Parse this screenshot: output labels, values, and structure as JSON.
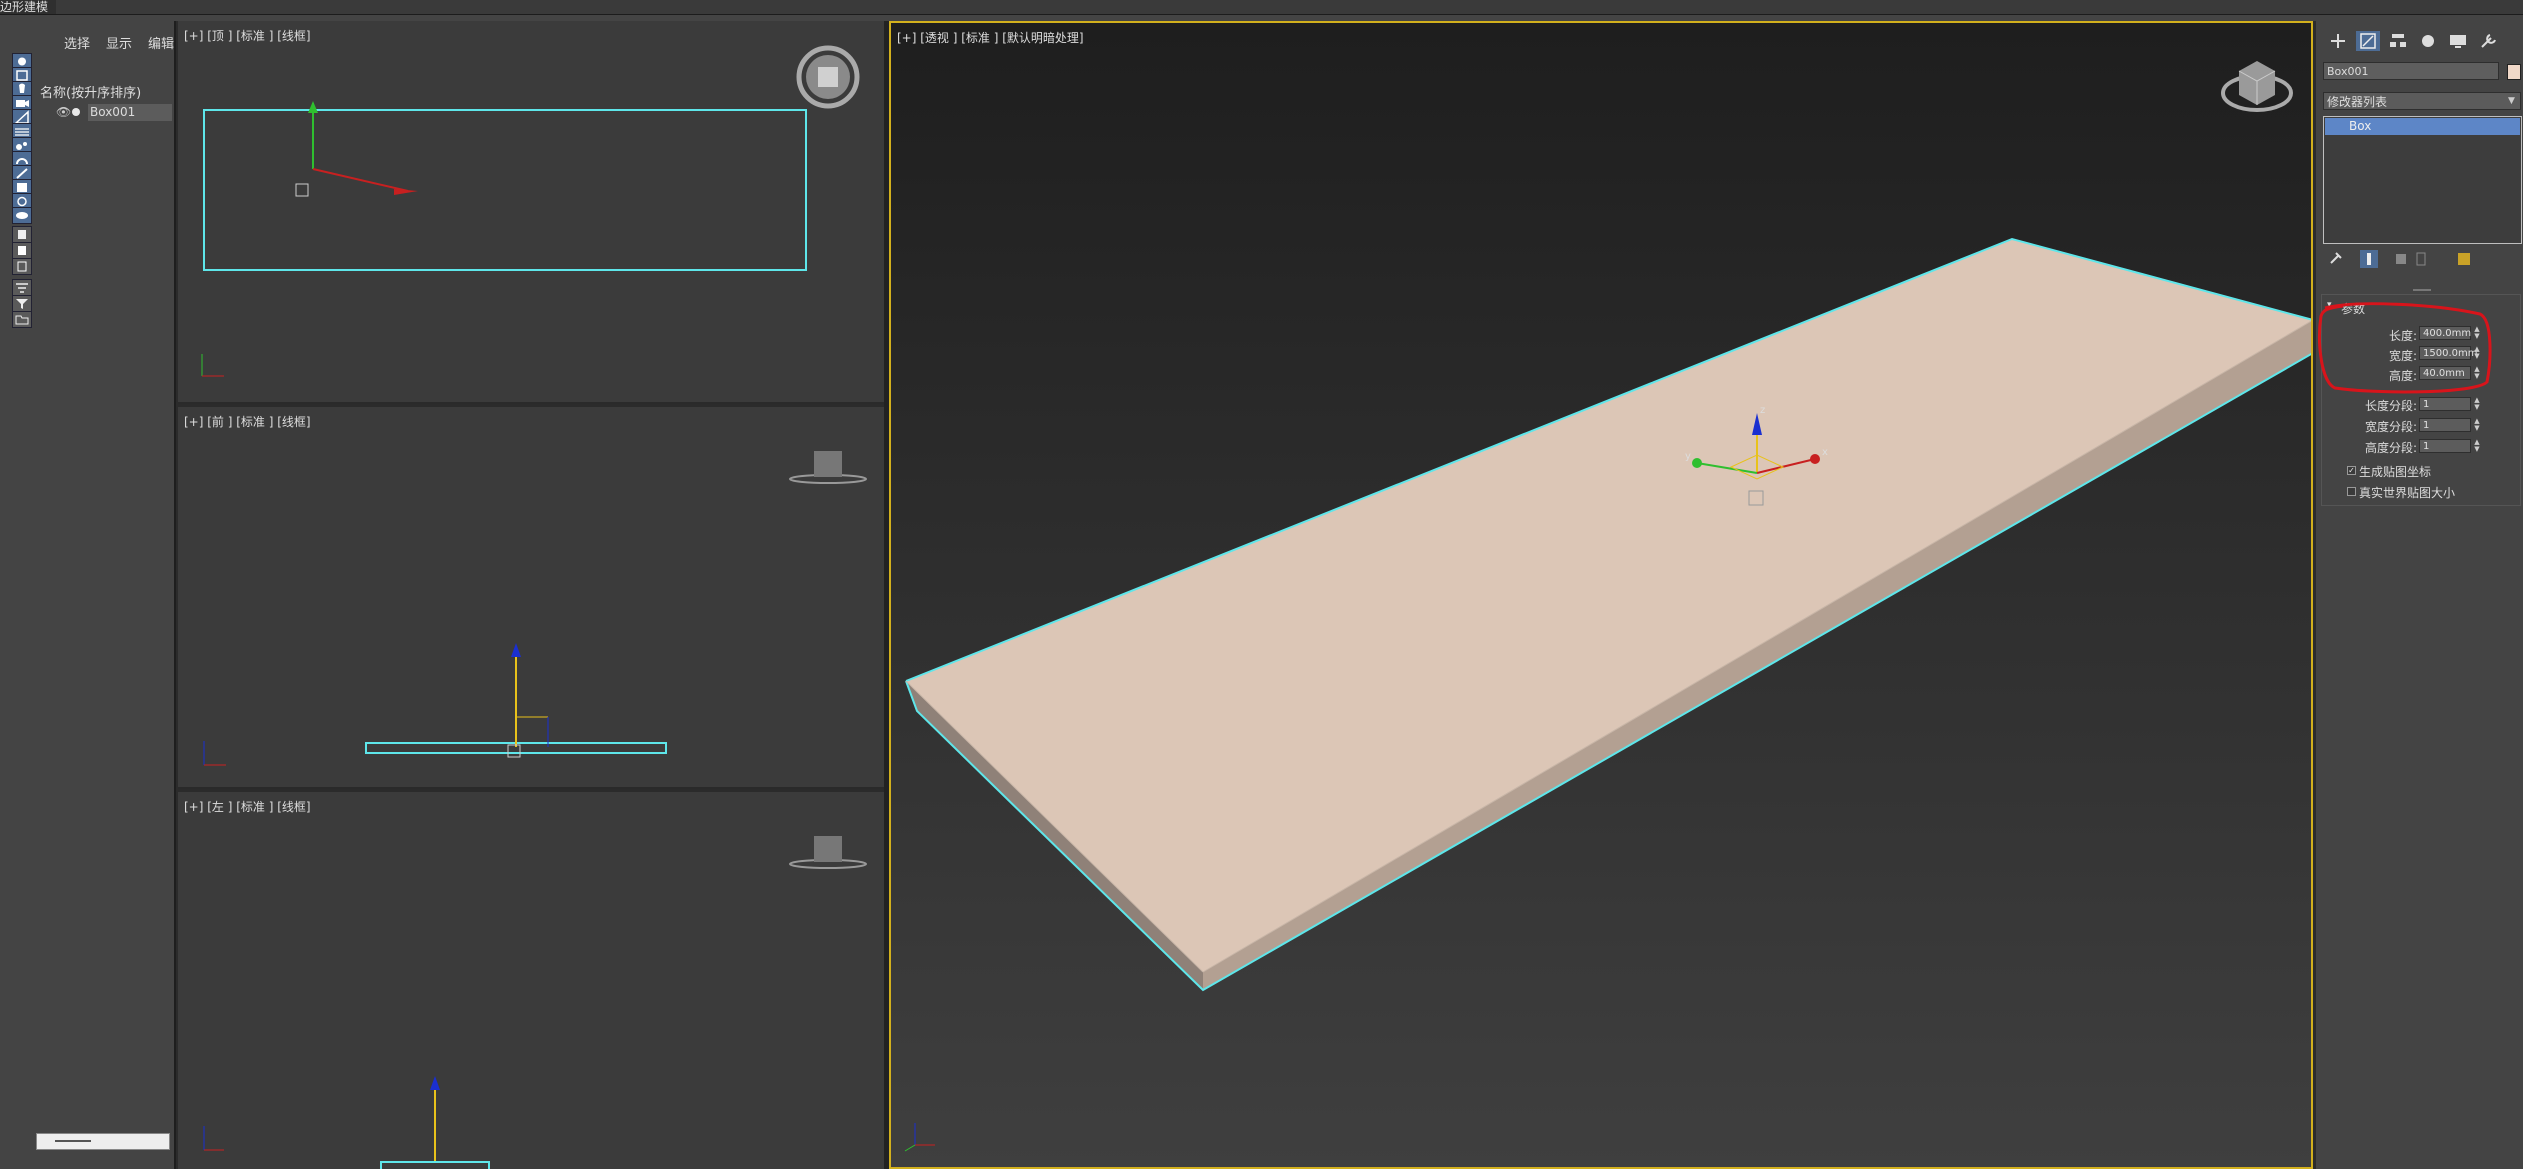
{
  "app": {
    "title": "边形建模"
  },
  "explorer": {
    "menus": [
      "选择",
      "显示",
      "编辑"
    ],
    "header": "名称(按升序排序)",
    "items": [
      {
        "name": "Box001"
      }
    ]
  },
  "viewports": {
    "top": {
      "label": "[+] [顶 ] [标准 ] [线框]"
    },
    "front": {
      "label": "[+] [前 ] [标准 ] [线框]"
    },
    "left": {
      "label": "[+] [左 ] [标准 ] [线框]"
    },
    "perspective": {
      "label": "[+] [透视 ] [标准 ] [默认明暗处理]"
    }
  },
  "gizmo_labels": {
    "x": "x",
    "y": "y",
    "z": "z"
  },
  "command_panel": {
    "object_name": "Box001",
    "object_color": "#f0d8c8",
    "modifier_list": "修改器列表",
    "stack_item": "Box",
    "rollout_title": "参数",
    "params": [
      {
        "label": "长度:",
        "value": "400.0mm"
      },
      {
        "label": "宽度:",
        "value": "1500.0mm"
      },
      {
        "label": "高度:",
        "value": "40.0mm"
      },
      {
        "label": "长度分段:",
        "value": "1"
      },
      {
        "label": "宽度分段:",
        "value": "1"
      },
      {
        "label": "高度分段:",
        "value": "1"
      }
    ],
    "checkboxes": [
      {
        "label": "生成贴图坐标",
        "checked": true
      },
      {
        "label": "真实世界贴图大小",
        "checked": false
      }
    ]
  },
  "colors": {
    "selection_wire": "#5ee6ea",
    "box_top": "#dcc6b6",
    "box_side": "#b8a496",
    "box_end": "#8f8178",
    "active_viewport_border": "#d2b01d",
    "highlight_circle": "#d8141b"
  }
}
